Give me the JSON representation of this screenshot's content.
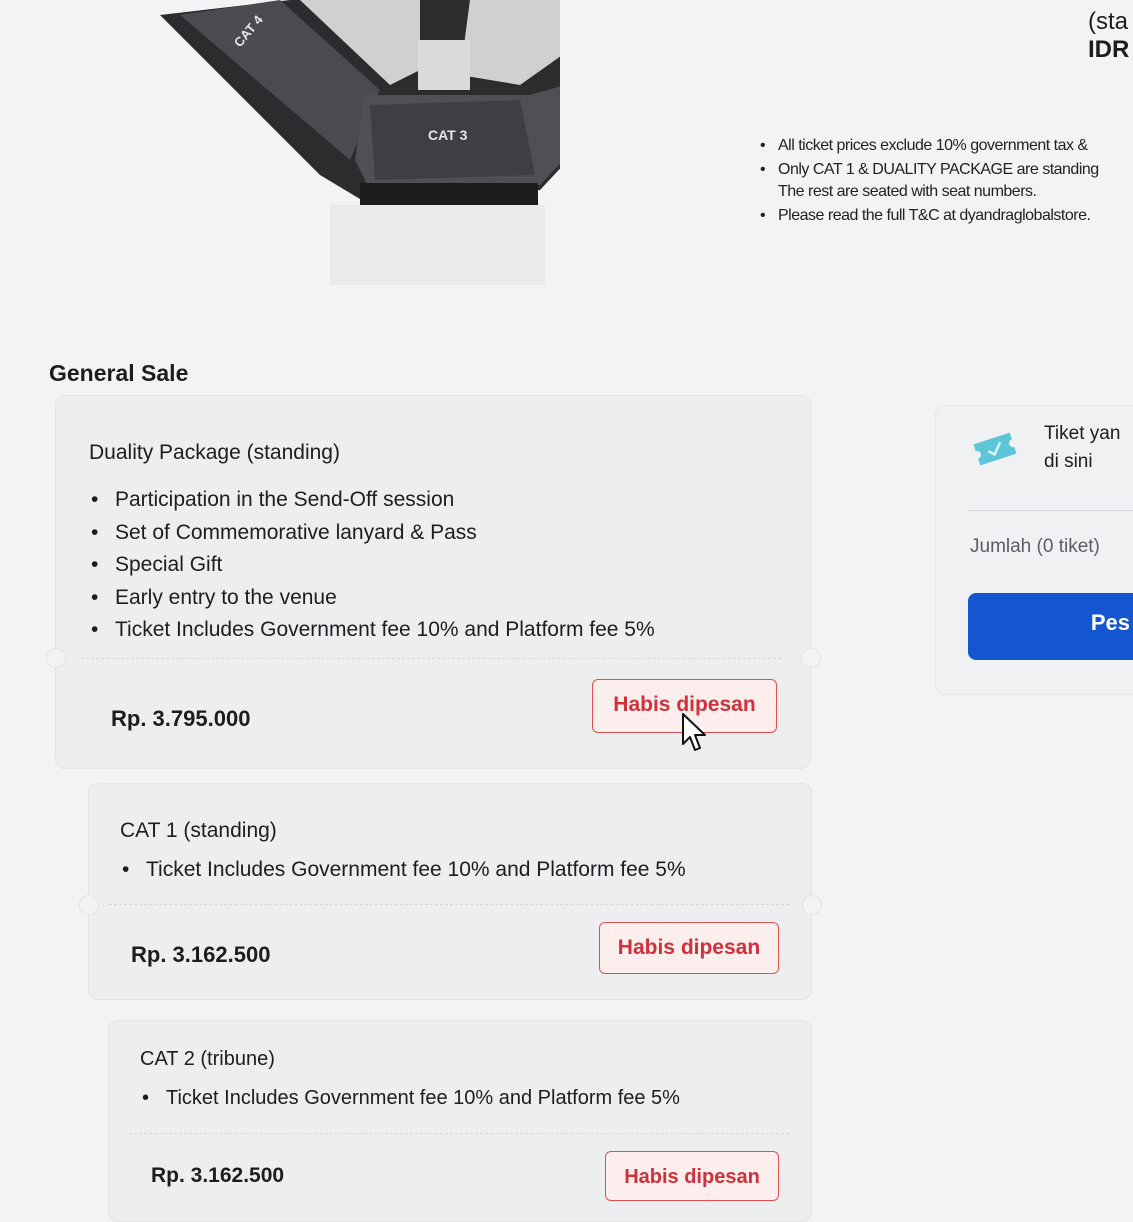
{
  "venue_map": {
    "sections": [
      "CAT 4",
      "CAT 3"
    ]
  },
  "top_right": {
    "line1": "(sta",
    "line2": "IDR"
  },
  "notes": [
    "All ticket prices exclude 10% government tax &",
    "Only CAT 1 & DUALITY PACKAGE are standing",
    "The rest are seated with seat numbers.",
    "Please read the full T&C at dyandraglobalstore."
  ],
  "general_sale": {
    "title": "General Sale",
    "tickets": [
      {
        "name": "Duality Package (standing)",
        "benefits": [
          "Participation in the Send-Off session",
          "Set of Commemorative lanyard & Pass",
          "Special Gift",
          "Early entry to the venue",
          "Ticket Includes Government fee 10% and Platform fee 5%"
        ],
        "price": "Rp. 3.795.000",
        "status": "Habis dipesan"
      },
      {
        "name": "CAT 1 (standing)",
        "benefits": [
          "Ticket Includes Government fee 10% and Platform fee 5%"
        ],
        "price": "Rp. 3.162.500",
        "status": "Habis dipesan"
      },
      {
        "name": "CAT 2 (tribune)",
        "benefits": [
          "Ticket Includes Government fee 10% and Platform fee 5%"
        ],
        "price": "Rp. 3.162.500",
        "status": "Habis dipesan"
      }
    ]
  },
  "side_panel": {
    "icon": "ticket-icon",
    "message_line1": "Tiket yan",
    "message_line2": "di sini",
    "quantity": "Jumlah (0 tiket)",
    "order_label": "Pes",
    "accent": "#1456d0"
  }
}
